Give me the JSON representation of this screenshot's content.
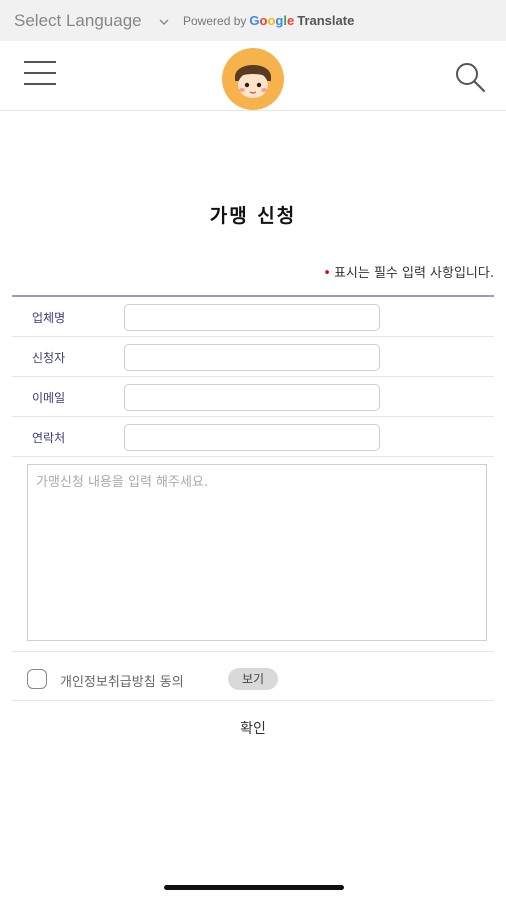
{
  "translate_bar": {
    "select_label": "Select Language",
    "powered_by": "Powered by",
    "google_letters": [
      "G",
      "o",
      "o",
      "g",
      "l",
      "e"
    ],
    "translate_word": "Translate"
  },
  "header": {
    "menu_icon": "hamburger-menu-icon",
    "logo": "character-logo",
    "search_icon": "search-icon"
  },
  "page": {
    "title": "가맹 신청",
    "required_note": {
      "marker": "•",
      "text": "표시는 필수 입력 사항입니다."
    }
  },
  "form": {
    "fields": [
      {
        "label": "업체명",
        "value": ""
      },
      {
        "label": "신청자",
        "value": ""
      },
      {
        "label": "이메일",
        "value": ""
      },
      {
        "label": "연락처",
        "value": ""
      }
    ],
    "message_placeholder": "가맹신청 내용을 입력 해주세요.",
    "agree_label": "개인정보취급방침 동의",
    "agree_checked": false,
    "view_button": "보기",
    "confirm_button": "확인"
  },
  "colors": {
    "label_text": "#3d3d7a",
    "required_marker": "#e60012",
    "form_top_border": "#9a9ac2",
    "logo_face": "#f7b34b"
  }
}
